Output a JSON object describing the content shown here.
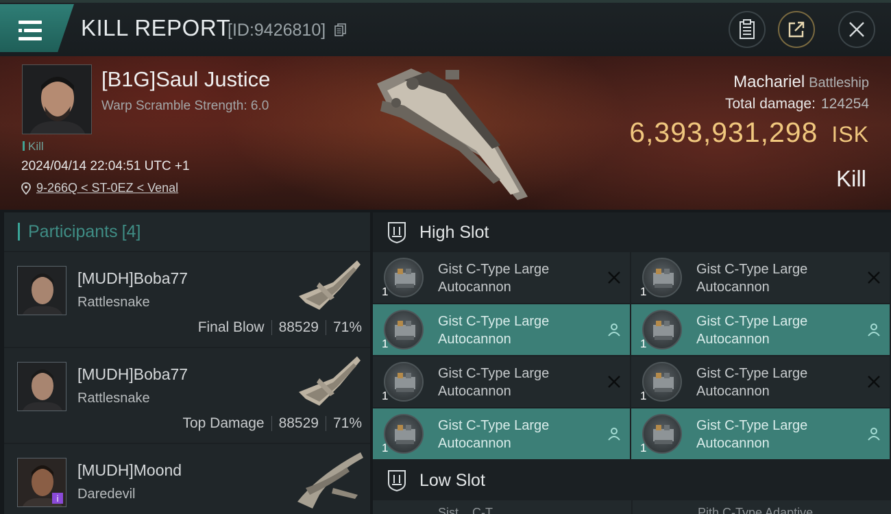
{
  "header": {
    "title": "KILL REPORT",
    "report_id": "[ID:9426810]"
  },
  "victim": {
    "name": "[B1G]Saul Justice",
    "warp_scramble": "Warp Scramble Strength: 6.0",
    "kill_tag": "Kill",
    "timestamp": "2024/04/14 22:04:51 UTC +1",
    "location": "9-266Q < ST-0EZ < Venal",
    "ship": "Machariel",
    "ship_class": "Battleship",
    "total_damage_label": "Total damage:",
    "total_damage": "124254",
    "isk_value": "6,393,931,298",
    "isk_unit": "ISK",
    "result": "Kill"
  },
  "participants": {
    "label": "Participants",
    "count": "[4]",
    "rows": [
      {
        "name": "[MUDH]Boba77",
        "ship": "Rattlesnake",
        "role": "Final Blow",
        "damage": "88529",
        "percent": "71%"
      },
      {
        "name": "[MUDH]Boba77",
        "ship": "Rattlesnake",
        "role": "Top Damage",
        "damage": "88529",
        "percent": "71%"
      },
      {
        "name": "[MUDH]Moond",
        "ship": "Daredevil",
        "role": "",
        "damage": "",
        "percent": ""
      }
    ]
  },
  "fitting": {
    "high_slot_label": "High Slot",
    "low_slot_label": "Low Slot",
    "high_modules": [
      {
        "name_line1": "Gist C-Type Large",
        "name_line2": "Autocannon",
        "qty": "1",
        "state": "destroyed"
      },
      {
        "name_line1": "Gist C-Type Large",
        "name_line2": "Autocannon",
        "qty": "1",
        "state": "destroyed"
      },
      {
        "name_line1": "Gist C-Type Large",
        "name_line2": "Autocannon",
        "qty": "1",
        "state": "dropped"
      },
      {
        "name_line1": "Gist C-Type Large",
        "name_line2": "Autocannon",
        "qty": "1",
        "state": "dropped"
      },
      {
        "name_line1": "Gist C-Type Large",
        "name_line2": "Autocannon",
        "qty": "1",
        "state": "destroyed"
      },
      {
        "name_line1": "Gist C-Type Large",
        "name_line2": "Autocannon",
        "qty": "1",
        "state": "destroyed"
      },
      {
        "name_line1": "Gist C-Type Large",
        "name_line2": "Autocannon",
        "qty": "1",
        "state": "dropped"
      },
      {
        "name_line1": "Gist C-Type Large",
        "name_line2": "Autocannon",
        "qty": "1",
        "state": "dropped"
      }
    ],
    "low_peek": [
      "Sist... C-T...",
      "Pith C-Type Adaptive"
    ]
  },
  "colors": {
    "accent": "#3c7f77",
    "isk": "#f0c77e",
    "panel": "#1b2023"
  }
}
